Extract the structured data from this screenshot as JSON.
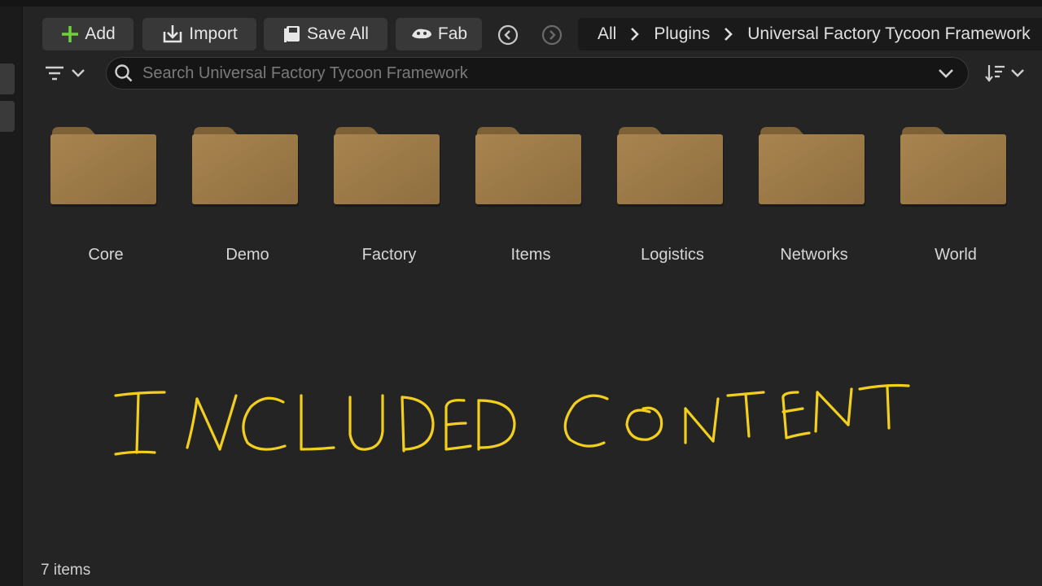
{
  "toolbar": {
    "add_label": "Add",
    "import_label": "Import",
    "save_all_label": "Save All",
    "fab_label": "Fab"
  },
  "breadcrumb": [
    "All",
    "Plugins",
    "Universal Factory Tycoon Framework"
  ],
  "search": {
    "placeholder": "Search Universal Factory Tycoon Framework",
    "value": ""
  },
  "folders": [
    "Core",
    "Demo",
    "Factory",
    "Items",
    "Logistics",
    "Networks",
    "World"
  ],
  "annotation": "INCLUDED CONTENT",
  "status": {
    "item_count": "7 items"
  },
  "colors": {
    "background": "#242424",
    "folder": "#9c7a48",
    "annotation": "#f2cf1f",
    "add_icon": "#6fcf3c"
  },
  "icons": [
    "plus-icon",
    "import-icon",
    "save-icon",
    "fab-icon",
    "back-icon",
    "forward-icon",
    "chevron-right-icon",
    "filter-icon",
    "search-icon",
    "chevron-down-icon",
    "sort-icon",
    "folder-icon"
  ]
}
